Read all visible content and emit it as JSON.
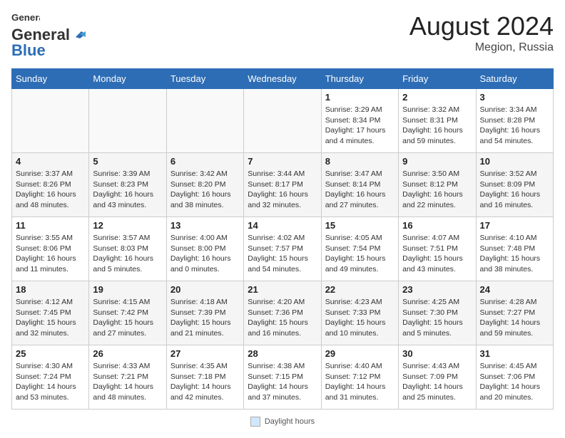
{
  "header": {
    "logo_line1": "General",
    "logo_line2": "Blue",
    "month_year": "August 2024",
    "location": "Megion, Russia"
  },
  "footer": {
    "legend_label": "Daylight hours"
  },
  "weekdays": [
    "Sunday",
    "Monday",
    "Tuesday",
    "Wednesday",
    "Thursday",
    "Friday",
    "Saturday"
  ],
  "weeks": [
    [
      {
        "day": "",
        "info": ""
      },
      {
        "day": "",
        "info": ""
      },
      {
        "day": "",
        "info": ""
      },
      {
        "day": "",
        "info": ""
      },
      {
        "day": "1",
        "info": "Sunrise: 3:29 AM\nSunset: 8:34 PM\nDaylight: 17 hours\nand 4 minutes."
      },
      {
        "day": "2",
        "info": "Sunrise: 3:32 AM\nSunset: 8:31 PM\nDaylight: 16 hours\nand 59 minutes."
      },
      {
        "day": "3",
        "info": "Sunrise: 3:34 AM\nSunset: 8:28 PM\nDaylight: 16 hours\nand 54 minutes."
      }
    ],
    [
      {
        "day": "4",
        "info": "Sunrise: 3:37 AM\nSunset: 8:26 PM\nDaylight: 16 hours\nand 48 minutes."
      },
      {
        "day": "5",
        "info": "Sunrise: 3:39 AM\nSunset: 8:23 PM\nDaylight: 16 hours\nand 43 minutes."
      },
      {
        "day": "6",
        "info": "Sunrise: 3:42 AM\nSunset: 8:20 PM\nDaylight: 16 hours\nand 38 minutes."
      },
      {
        "day": "7",
        "info": "Sunrise: 3:44 AM\nSunset: 8:17 PM\nDaylight: 16 hours\nand 32 minutes."
      },
      {
        "day": "8",
        "info": "Sunrise: 3:47 AM\nSunset: 8:14 PM\nDaylight: 16 hours\nand 27 minutes."
      },
      {
        "day": "9",
        "info": "Sunrise: 3:50 AM\nSunset: 8:12 PM\nDaylight: 16 hours\nand 22 minutes."
      },
      {
        "day": "10",
        "info": "Sunrise: 3:52 AM\nSunset: 8:09 PM\nDaylight: 16 hours\nand 16 minutes."
      }
    ],
    [
      {
        "day": "11",
        "info": "Sunrise: 3:55 AM\nSunset: 8:06 PM\nDaylight: 16 hours\nand 11 minutes."
      },
      {
        "day": "12",
        "info": "Sunrise: 3:57 AM\nSunset: 8:03 PM\nDaylight: 16 hours\nand 5 minutes."
      },
      {
        "day": "13",
        "info": "Sunrise: 4:00 AM\nSunset: 8:00 PM\nDaylight: 16 hours\nand 0 minutes."
      },
      {
        "day": "14",
        "info": "Sunrise: 4:02 AM\nSunset: 7:57 PM\nDaylight: 15 hours\nand 54 minutes."
      },
      {
        "day": "15",
        "info": "Sunrise: 4:05 AM\nSunset: 7:54 PM\nDaylight: 15 hours\nand 49 minutes."
      },
      {
        "day": "16",
        "info": "Sunrise: 4:07 AM\nSunset: 7:51 PM\nDaylight: 15 hours\nand 43 minutes."
      },
      {
        "day": "17",
        "info": "Sunrise: 4:10 AM\nSunset: 7:48 PM\nDaylight: 15 hours\nand 38 minutes."
      }
    ],
    [
      {
        "day": "18",
        "info": "Sunrise: 4:12 AM\nSunset: 7:45 PM\nDaylight: 15 hours\nand 32 minutes."
      },
      {
        "day": "19",
        "info": "Sunrise: 4:15 AM\nSunset: 7:42 PM\nDaylight: 15 hours\nand 27 minutes."
      },
      {
        "day": "20",
        "info": "Sunrise: 4:18 AM\nSunset: 7:39 PM\nDaylight: 15 hours\nand 21 minutes."
      },
      {
        "day": "21",
        "info": "Sunrise: 4:20 AM\nSunset: 7:36 PM\nDaylight: 15 hours\nand 16 minutes."
      },
      {
        "day": "22",
        "info": "Sunrise: 4:23 AM\nSunset: 7:33 PM\nDaylight: 15 hours\nand 10 minutes."
      },
      {
        "day": "23",
        "info": "Sunrise: 4:25 AM\nSunset: 7:30 PM\nDaylight: 15 hours\nand 5 minutes."
      },
      {
        "day": "24",
        "info": "Sunrise: 4:28 AM\nSunset: 7:27 PM\nDaylight: 14 hours\nand 59 minutes."
      }
    ],
    [
      {
        "day": "25",
        "info": "Sunrise: 4:30 AM\nSunset: 7:24 PM\nDaylight: 14 hours\nand 53 minutes."
      },
      {
        "day": "26",
        "info": "Sunrise: 4:33 AM\nSunset: 7:21 PM\nDaylight: 14 hours\nand 48 minutes."
      },
      {
        "day": "27",
        "info": "Sunrise: 4:35 AM\nSunset: 7:18 PM\nDaylight: 14 hours\nand 42 minutes."
      },
      {
        "day": "28",
        "info": "Sunrise: 4:38 AM\nSunset: 7:15 PM\nDaylight: 14 hours\nand 37 minutes."
      },
      {
        "day": "29",
        "info": "Sunrise: 4:40 AM\nSunset: 7:12 PM\nDaylight: 14 hours\nand 31 minutes."
      },
      {
        "day": "30",
        "info": "Sunrise: 4:43 AM\nSunset: 7:09 PM\nDaylight: 14 hours\nand 25 minutes."
      },
      {
        "day": "31",
        "info": "Sunrise: 4:45 AM\nSunset: 7:06 PM\nDaylight: 14 hours\nand 20 minutes."
      }
    ]
  ]
}
